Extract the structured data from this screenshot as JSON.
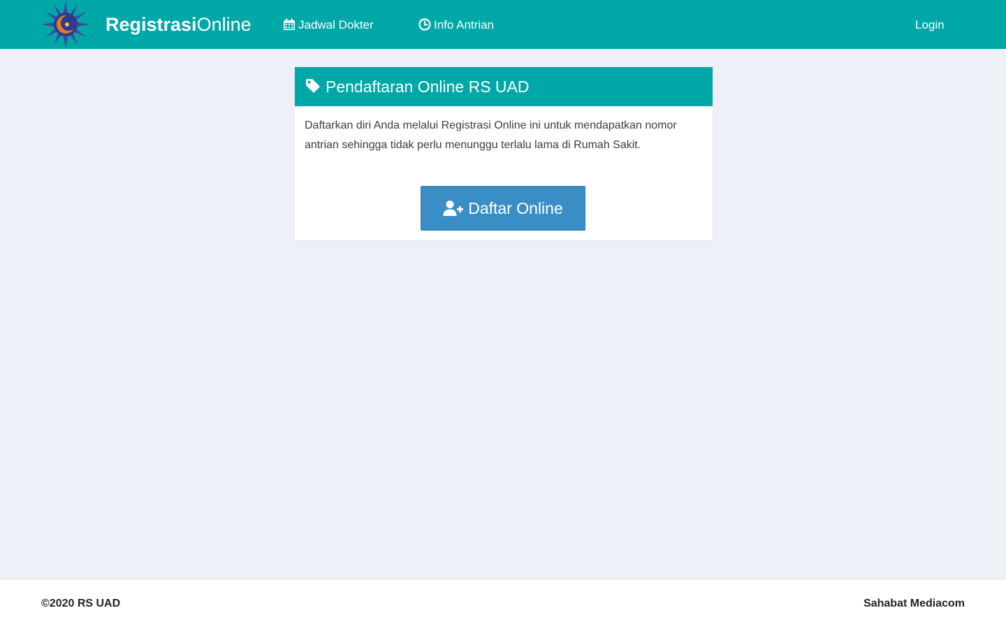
{
  "navbar": {
    "brand_bold": "Registrasi",
    "brand_light": "Online",
    "jadwal_label": "Jadwal Dokter",
    "antrian_label": "Info Antrian",
    "login_label": "Login",
    "logo_icon": "muhammadiyah-sun-logo",
    "jadwal_icon": "calendar-icon",
    "antrian_icon": "clock-icon",
    "colors": {
      "primary": "#00a7a7",
      "button": "#3a8ec6",
      "background": "#edf0f6"
    }
  },
  "card": {
    "title": "Pendaftaran Online RS UAD",
    "title_icon": "tag-icon",
    "description": "Daftarkan diri Anda melalui Registrasi Online ini untuk mendapatkan nomor antrian sehingga tidak perlu menunggu terlalu lama di Rumah Sakit.",
    "button_label": "Daftar Online",
    "button_icon": "user-plus-icon"
  },
  "footer": {
    "copyright": "©2020 RS UAD",
    "credit": "Sahabat Mediacom"
  }
}
